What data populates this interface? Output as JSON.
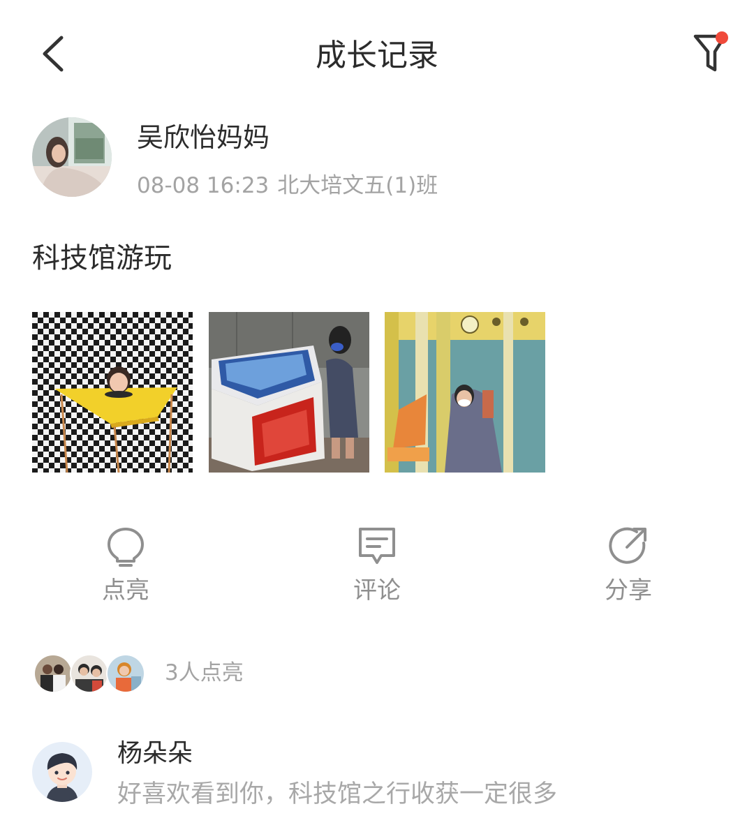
{
  "header": {
    "title": "成长记录",
    "icons": {
      "back": "chevron-left-icon",
      "filter": "filter-icon"
    },
    "filter_dot_color": "#f04a3a"
  },
  "post": {
    "author": "吴欣怡妈妈",
    "time": "08-08 16:23",
    "class_name": "北大培文五(1)班",
    "text": "科技馆游玩",
    "photos": [
      {
        "name": "photo-checkerboard-illusion"
      },
      {
        "name": "photo-touchscreen-kiosk"
      },
      {
        "name": "photo-swing-playground"
      }
    ]
  },
  "actions": {
    "like": {
      "label": "点亮",
      "icon": "lightbulb-icon"
    },
    "comment": {
      "label": "评论",
      "icon": "comment-icon"
    },
    "share": {
      "label": "分享",
      "icon": "share-icon"
    }
  },
  "likes": {
    "count_text": "3人点亮",
    "avatar_count": 3
  },
  "comments": [
    {
      "name": "杨朵朵",
      "text": "好喜欢看到你，科技馆之行收获一定很多"
    }
  ],
  "colors": {
    "text_primary": "#2b2b2b",
    "text_secondary": "#a3a3a3",
    "icon_gray": "#8f8f8f"
  }
}
